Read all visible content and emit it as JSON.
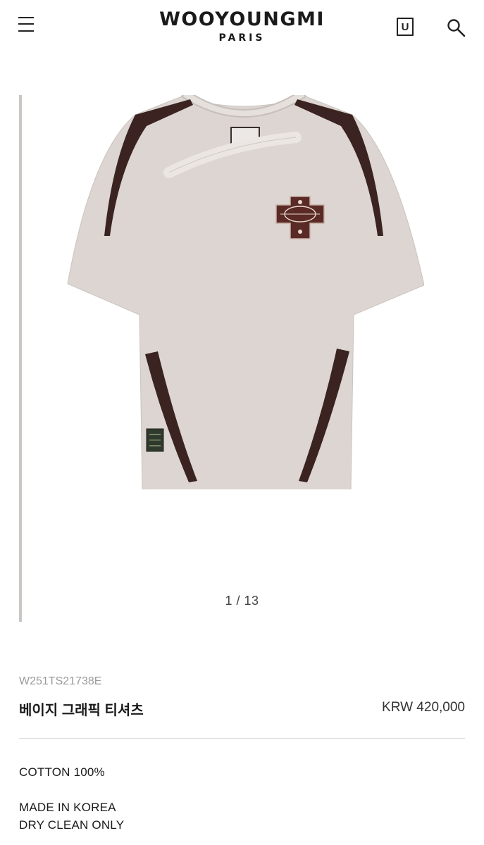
{
  "header": {
    "brand": "WOOYOUNGMI",
    "brand_sub": "PARIS",
    "bag_label": "U"
  },
  "icons": {
    "menu": "hamburger-menu-icon",
    "bag": "shopping-bag-icon",
    "search": "search-icon"
  },
  "gallery": {
    "counter": "1 / 13",
    "product_color": "#dcd5d2",
    "trim_color": "#3a2320",
    "badge_color": "#5a2a26"
  },
  "product": {
    "sku": "W251TS21738E",
    "name": "베이지 그래픽 티셔츠",
    "price": "KRW 420,000"
  },
  "details": {
    "composition": "COTTON 100%",
    "origin": "MADE IN KOREA",
    "care": "DRY CLEAN ONLY"
  }
}
